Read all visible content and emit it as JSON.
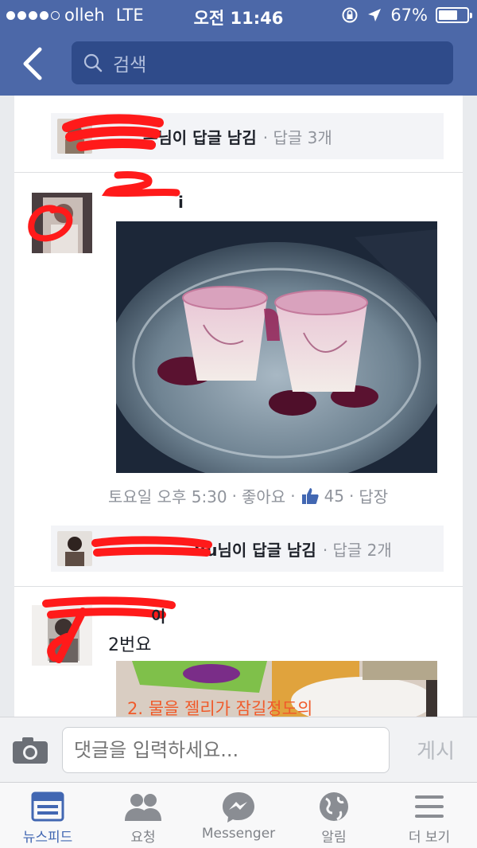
{
  "statusbar": {
    "carrier": "olleh",
    "network": "LTE",
    "time": "오전 11:46",
    "battery": "67%",
    "battery_level": 0.67
  },
  "navbar": {
    "search_placeholder": "검색"
  },
  "reply_top": {
    "name_suffix": "은님이 답글 남김",
    "meta": "· 답글 3개"
  },
  "post1": {
    "author": "i",
    "timestamp": "토요일 오후 5:30",
    "like": "좋아요",
    "like_count": "45",
    "reply": "답장",
    "sep": "·"
  },
  "reply_mid": {
    "name_suffix": "Bu님이 답글 남김",
    "meta": "· 답글 2개"
  },
  "post2": {
    "author": "이",
    "text": "2번요",
    "photo_caption": "2. 물을 젤리가 잠길정도의"
  },
  "composer": {
    "placeholder": "댓글을 입력하세요...",
    "post_button": "게시"
  },
  "tabs": [
    {
      "label": "뉴스피드",
      "icon": "news-feed-icon"
    },
    {
      "label": "요청",
      "icon": "friend-requests-icon"
    },
    {
      "label": "Messenger",
      "icon": "messenger-icon"
    },
    {
      "label": "알림",
      "icon": "notifications-globe-icon"
    },
    {
      "label": "더 보기",
      "icon": "more-menu-icon"
    }
  ],
  "colors": {
    "brand": "#4c68a8",
    "accent": "#4267b2",
    "redaction": "#ff1a1a"
  }
}
